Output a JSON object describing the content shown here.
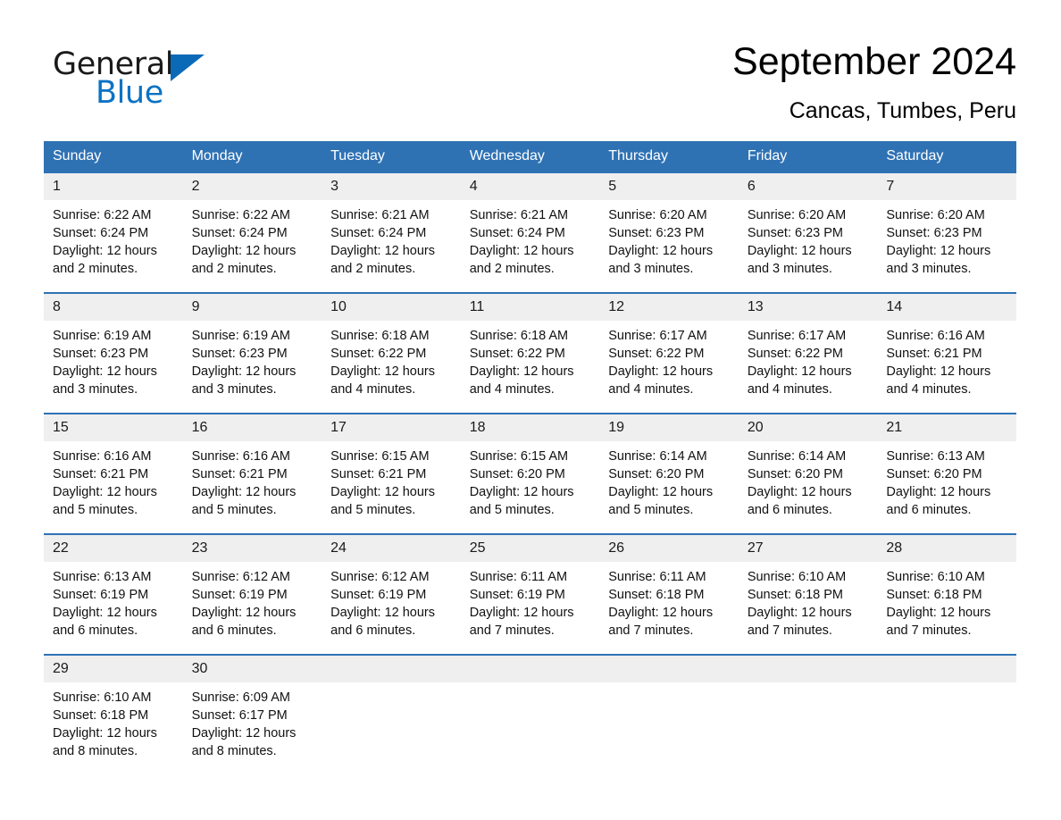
{
  "brand": {
    "name_part1": "General",
    "name_part2": "Blue",
    "triangle_color": "#0b6ab8",
    "blue_color": "#0b72c4"
  },
  "header": {
    "title": "September 2024",
    "location": "Cancas, Tumbes, Peru"
  },
  "theme": {
    "header_blue": "#2f72b4",
    "daynum_band": "#efefef",
    "row_divider": "#2f72b4"
  },
  "weekday_headers": [
    "Sunday",
    "Monday",
    "Tuesday",
    "Wednesday",
    "Thursday",
    "Friday",
    "Saturday"
  ],
  "weeks": [
    {
      "days": [
        {
          "num": "1",
          "sunrise": "Sunrise: 6:22 AM",
          "sunset": "Sunset: 6:24 PM",
          "daylight": "Daylight: 12 hours and 2 minutes."
        },
        {
          "num": "2",
          "sunrise": "Sunrise: 6:22 AM",
          "sunset": "Sunset: 6:24 PM",
          "daylight": "Daylight: 12 hours and 2 minutes."
        },
        {
          "num": "3",
          "sunrise": "Sunrise: 6:21 AM",
          "sunset": "Sunset: 6:24 PM",
          "daylight": "Daylight: 12 hours and 2 minutes."
        },
        {
          "num": "4",
          "sunrise": "Sunrise: 6:21 AM",
          "sunset": "Sunset: 6:24 PM",
          "daylight": "Daylight: 12 hours and 2 minutes."
        },
        {
          "num": "5",
          "sunrise": "Sunrise: 6:20 AM",
          "sunset": "Sunset: 6:23 PM",
          "daylight": "Daylight: 12 hours and 3 minutes."
        },
        {
          "num": "6",
          "sunrise": "Sunrise: 6:20 AM",
          "sunset": "Sunset: 6:23 PM",
          "daylight": "Daylight: 12 hours and 3 minutes."
        },
        {
          "num": "7",
          "sunrise": "Sunrise: 6:20 AM",
          "sunset": "Sunset: 6:23 PM",
          "daylight": "Daylight: 12 hours and 3 minutes."
        }
      ]
    },
    {
      "days": [
        {
          "num": "8",
          "sunrise": "Sunrise: 6:19 AM",
          "sunset": "Sunset: 6:23 PM",
          "daylight": "Daylight: 12 hours and 3 minutes."
        },
        {
          "num": "9",
          "sunrise": "Sunrise: 6:19 AM",
          "sunset": "Sunset: 6:23 PM",
          "daylight": "Daylight: 12 hours and 3 minutes."
        },
        {
          "num": "10",
          "sunrise": "Sunrise: 6:18 AM",
          "sunset": "Sunset: 6:22 PM",
          "daylight": "Daylight: 12 hours and 4 minutes."
        },
        {
          "num": "11",
          "sunrise": "Sunrise: 6:18 AM",
          "sunset": "Sunset: 6:22 PM",
          "daylight": "Daylight: 12 hours and 4 minutes."
        },
        {
          "num": "12",
          "sunrise": "Sunrise: 6:17 AM",
          "sunset": "Sunset: 6:22 PM",
          "daylight": "Daylight: 12 hours and 4 minutes."
        },
        {
          "num": "13",
          "sunrise": "Sunrise: 6:17 AM",
          "sunset": "Sunset: 6:22 PM",
          "daylight": "Daylight: 12 hours and 4 minutes."
        },
        {
          "num": "14",
          "sunrise": "Sunrise: 6:16 AM",
          "sunset": "Sunset: 6:21 PM",
          "daylight": "Daylight: 12 hours and 4 minutes."
        }
      ]
    },
    {
      "days": [
        {
          "num": "15",
          "sunrise": "Sunrise: 6:16 AM",
          "sunset": "Sunset: 6:21 PM",
          "daylight": "Daylight: 12 hours and 5 minutes."
        },
        {
          "num": "16",
          "sunrise": "Sunrise: 6:16 AM",
          "sunset": "Sunset: 6:21 PM",
          "daylight": "Daylight: 12 hours and 5 minutes."
        },
        {
          "num": "17",
          "sunrise": "Sunrise: 6:15 AM",
          "sunset": "Sunset: 6:21 PM",
          "daylight": "Daylight: 12 hours and 5 minutes."
        },
        {
          "num": "18",
          "sunrise": "Sunrise: 6:15 AM",
          "sunset": "Sunset: 6:20 PM",
          "daylight": "Daylight: 12 hours and 5 minutes."
        },
        {
          "num": "19",
          "sunrise": "Sunrise: 6:14 AM",
          "sunset": "Sunset: 6:20 PM",
          "daylight": "Daylight: 12 hours and 5 minutes."
        },
        {
          "num": "20",
          "sunrise": "Sunrise: 6:14 AM",
          "sunset": "Sunset: 6:20 PM",
          "daylight": "Daylight: 12 hours and 6 minutes."
        },
        {
          "num": "21",
          "sunrise": "Sunrise: 6:13 AM",
          "sunset": "Sunset: 6:20 PM",
          "daylight": "Daylight: 12 hours and 6 minutes."
        }
      ]
    },
    {
      "days": [
        {
          "num": "22",
          "sunrise": "Sunrise: 6:13 AM",
          "sunset": "Sunset: 6:19 PM",
          "daylight": "Daylight: 12 hours and 6 minutes."
        },
        {
          "num": "23",
          "sunrise": "Sunrise: 6:12 AM",
          "sunset": "Sunset: 6:19 PM",
          "daylight": "Daylight: 12 hours and 6 minutes."
        },
        {
          "num": "24",
          "sunrise": "Sunrise: 6:12 AM",
          "sunset": "Sunset: 6:19 PM",
          "daylight": "Daylight: 12 hours and 6 minutes."
        },
        {
          "num": "25",
          "sunrise": "Sunrise: 6:11 AM",
          "sunset": "Sunset: 6:19 PM",
          "daylight": "Daylight: 12 hours and 7 minutes."
        },
        {
          "num": "26",
          "sunrise": "Sunrise: 6:11 AM",
          "sunset": "Sunset: 6:18 PM",
          "daylight": "Daylight: 12 hours and 7 minutes."
        },
        {
          "num": "27",
          "sunrise": "Sunrise: 6:10 AM",
          "sunset": "Sunset: 6:18 PM",
          "daylight": "Daylight: 12 hours and 7 minutes."
        },
        {
          "num": "28",
          "sunrise": "Sunrise: 6:10 AM",
          "sunset": "Sunset: 6:18 PM",
          "daylight": "Daylight: 12 hours and 7 minutes."
        }
      ]
    },
    {
      "days": [
        {
          "num": "29",
          "sunrise": "Sunrise: 6:10 AM",
          "sunset": "Sunset: 6:18 PM",
          "daylight": "Daylight: 12 hours and 8 minutes."
        },
        {
          "num": "30",
          "sunrise": "Sunrise: 6:09 AM",
          "sunset": "Sunset: 6:17 PM",
          "daylight": "Daylight: 12 hours and 8 minutes."
        },
        {
          "num": "",
          "sunrise": "",
          "sunset": "",
          "daylight": ""
        },
        {
          "num": "",
          "sunrise": "",
          "sunset": "",
          "daylight": ""
        },
        {
          "num": "",
          "sunrise": "",
          "sunset": "",
          "daylight": ""
        },
        {
          "num": "",
          "sunrise": "",
          "sunset": "",
          "daylight": ""
        },
        {
          "num": "",
          "sunrise": "",
          "sunset": "",
          "daylight": ""
        }
      ]
    }
  ]
}
